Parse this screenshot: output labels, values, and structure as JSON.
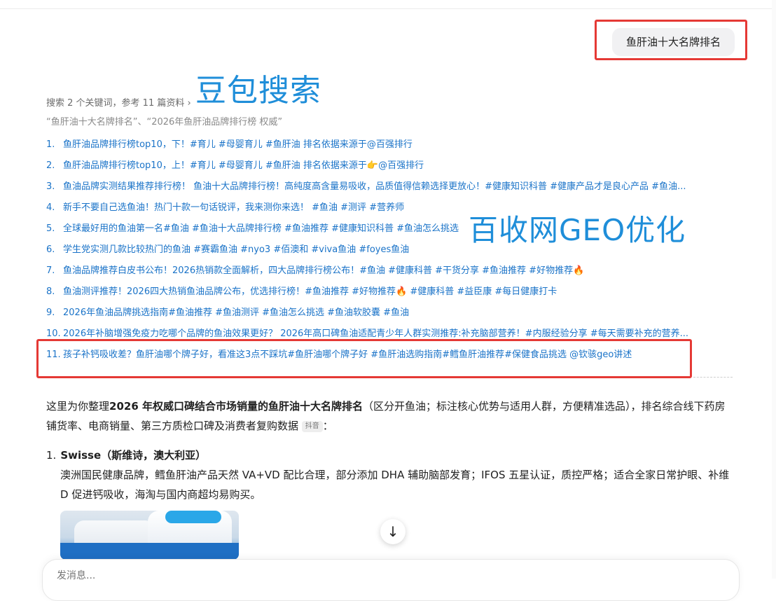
{
  "query": {
    "text": "鱼肝油十大名牌排名"
  },
  "overlays": {
    "doubao": "豆包搜索",
    "geo": "百收网GEO优化"
  },
  "search": {
    "meta": "搜索 2 个关键词，参考 11 篇资料 ›",
    "keywords": "“鱼肝油十大名牌排名”、“2026年鱼肝油品牌排行榜 权威”"
  },
  "references": [
    {
      "num": "1.",
      "text": "鱼肝油品牌排行榜top10，下！#育儿 #母婴育儿 #鱼肝油 排名依据来源于@百强排行"
    },
    {
      "num": "2.",
      "text": "鱼肝油品牌排行榜top10，上！#育儿 #母婴育儿 #鱼肝油 排名依据来源于👉@百强排行"
    },
    {
      "num": "3.",
      "text": "鱼油品牌实测结果推荐排行榜！ 鱼油十大品牌排行榜！高纯度高含量易吸收，品质值得信赖选择更放心！#健康知识科普 #健康产品才是良心产品 #鱼油..."
    },
    {
      "num": "4.",
      "text": "新手不要自己选鱼油！热门十款一句话锐评，我来测你来选！ #鱼油 #测评 #营养师"
    },
    {
      "num": "5.",
      "text": "全球最好用的鱼油第一名#鱼油 #鱼油十大品牌排行榜 #鱼油推荐 #健康知识科普 #鱼油怎么挑选"
    },
    {
      "num": "6.",
      "text": "学生党实测几款比较热门的鱼油 #赛霸鱼油 #nyo3 #佰澳和 #viva鱼油 #foyes鱼油"
    },
    {
      "num": "7.",
      "text": "鱼油品牌推荐白皮书公布！2026热销款全面解析，四大品牌排行榜公布！#鱼油 #健康科普 #干货分享 #鱼油推荐 #好物推荐🔥"
    },
    {
      "num": "8.",
      "text": "鱼油测评推荐！2026四大热销鱼油品牌公布，优选排行榜！#鱼油推荐 #好物推荐🔥 #健康科普 #益臣康 #每日健康打卡"
    },
    {
      "num": "9.",
      "text": "2026年鱼油品牌挑选指南#鱼油推荐 #鱼油测评 #鱼油怎么挑选 #鱼油软胶囊 #鱼油"
    },
    {
      "num": "10.",
      "text": "2026年补脑增强免疫力吃哪个品牌的鱼油效果更好？ 2026年高口碑鱼油适配青少年人群实测推荐:补充脑部营养！#内服经验分享 #每天需要补充的营养..."
    },
    {
      "num": "11.",
      "text": "孩子补钙吸收差？鱼肝油哪个牌子好，看准这3点不踩坑#鱼肝油哪个牌子好 #鱼肝油选购指南#鳕鱼肝油推荐#保健食品挑选 @钦骇geo讲述"
    }
  ],
  "answer": {
    "intro_prefix": "这里为你整理",
    "intro_bold": "2026 年权威口碑结合市场销量的鱼肝油十大名牌排名",
    "intro_suffix": "（区分开鱼油；标注核心优势与适用人群，方便精准选品），排名综合线下药房铺货率、电商销量、第三方质检口碑及消费者复购数据",
    "cite_chip": "抖音",
    "intro_end": "：",
    "items": [
      {
        "num": "1.",
        "title": "Swisse（斯维诗，澳大利亚）",
        "desc": "澳洲国民健康品牌，鳕鱼肝油产品天然 VA+VD 配比合理，部分添加 DHA 辅助脑部发育；IFOS 五星认证，质控严格；适合全家日常护眼、补维 D 促进钙吸收，海淘与国内商超均易购买。"
      }
    ]
  },
  "composer": {
    "placeholder": "发消息..."
  }
}
